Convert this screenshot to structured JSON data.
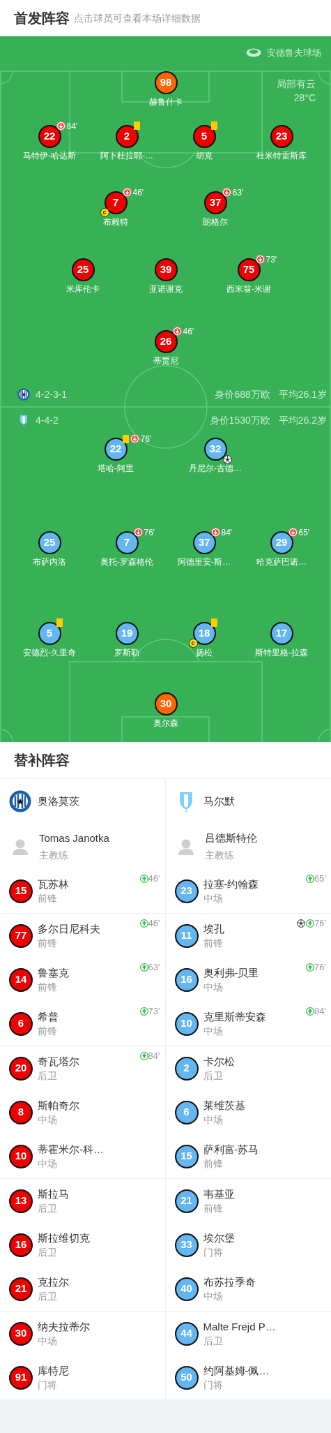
{
  "header": {
    "title": "首发阵容",
    "subtitle": "点击球员可查看本场详细数据"
  },
  "pitch": {
    "stadium": "安德鲁夫球场",
    "weather": {
      "condition": "局部有云",
      "temperature": "28°C"
    },
    "home_lines": [
      [
        {
          "number": "98",
          "name": "赫鲁什卡",
          "color": "#ff6600"
        }
      ],
      [
        {
          "number": "22",
          "name": "马特伊-哈达斯",
          "color": "#ee0000",
          "events": [
            {
              "kind": "sub_out",
              "minute": "84'"
            }
          ]
        },
        {
          "number": "2",
          "name": "阿卜杜拉耶-…",
          "color": "#ee0000",
          "events": [
            {
              "kind": "yellow"
            }
          ]
        },
        {
          "number": "5",
          "name": "胡克",
          "color": "#ee0000",
          "events": [
            {
              "kind": "yellow"
            }
          ]
        },
        {
          "number": "23",
          "name": "杜米特雷斯库",
          "color": "#ee0000"
        }
      ],
      [
        {
          "number": "7",
          "name": "布赖特",
          "color": "#ee0000",
          "events": [
            {
              "kind": "sub_out",
              "minute": "46'"
            },
            {
              "kind": "captain",
              "label": "c"
            }
          ]
        },
        {
          "number": "37",
          "name": "朗格尔",
          "color": "#ee0000",
          "events": [
            {
              "kind": "sub_out",
              "minute": "63'"
            }
          ]
        }
      ],
      [
        {
          "number": "25",
          "name": "米库伦卡",
          "color": "#ee0000"
        },
        {
          "number": "39",
          "name": "亚诺谢克",
          "color": "#ee0000"
        },
        {
          "number": "75",
          "name": "西米翁-米谢",
          "color": "#ee0000",
          "events": [
            {
              "kind": "sub_out",
              "minute": "73'"
            }
          ]
        }
      ],
      [
        {
          "number": "26",
          "name": "蒂贾尼",
          "color": "#ee0000",
          "events": [
            {
              "kind": "sub_out",
              "minute": "46'"
            }
          ]
        }
      ]
    ],
    "formations": [
      {
        "kind": "round",
        "formation": "4-2-3-1",
        "value": "身价688万欧",
        "avg_age": "平均26.1岁"
      },
      {
        "kind": "shield",
        "formation": "4-4-2",
        "value": "身价1530万欧",
        "avg_age": "平均26.2岁"
      }
    ],
    "away_lines": [
      [
        {
          "number": "22",
          "name": "塔哈-阿里",
          "color": "#63b6f0",
          "events": [
            {
              "kind": "yellow"
            },
            {
              "kind": "sub_out",
              "minute": "76'"
            }
          ]
        },
        {
          "number": "32",
          "name": "丹尼尔-古德…",
          "color": "#63b6f0",
          "events": [
            {
              "kind": "goal"
            }
          ]
        }
      ],
      [
        {
          "number": "25",
          "name": "布萨内洛",
          "color": "#63b6f0"
        },
        {
          "number": "7",
          "name": "奥托-罗森格伦",
          "color": "#63b6f0",
          "events": [
            {
              "kind": "sub_out",
              "minute": "76'"
            }
          ]
        },
        {
          "number": "37",
          "name": "阿德里安-斯…",
          "color": "#63b6f0",
          "events": [
            {
              "kind": "sub_out",
              "minute": "84'"
            }
          ]
        },
        {
          "number": "29",
          "name": "哈克萨巴诺…",
          "color": "#63b6f0",
          "events": [
            {
              "kind": "sub_out",
              "minute": "65'"
            }
          ]
        }
      ],
      [
        {
          "number": "5",
          "name": "安德烈-久里奇",
          "color": "#63b6f0",
          "events": [
            {
              "kind": "yellow"
            }
          ]
        },
        {
          "number": "19",
          "name": "罗斯勒",
          "color": "#63b6f0"
        },
        {
          "number": "18",
          "name": "扬松",
          "color": "#63b6f0",
          "events": [
            {
              "kind": "yellow"
            },
            {
              "kind": "captain",
              "label": "c"
            }
          ]
        },
        {
          "number": "17",
          "name": "斯特里格-拉森",
          "color": "#63b6f0"
        }
      ],
      [
        {
          "number": "30",
          "name": "奥尔森",
          "color": "#ff6600"
        }
      ]
    ]
  },
  "subs": {
    "title": "替补阵容",
    "teams": [
      {
        "kind": "round",
        "name": "奥洛莫茨",
        "color": "#ee0000",
        "coach": {
          "name": "Tomas Janotka",
          "role": "主教练"
        }
      },
      {
        "kind": "shield",
        "name": "马尔默",
        "color": "#63b6f0",
        "coach": {
          "name": "吕德斯特伦",
          "role": "主教练"
        }
      }
    ],
    "groups": [
      [
        {
          "home": {
            "number": "15",
            "name": "瓦苏林",
            "position": "前锋",
            "events": [
              {
                "kind": "sub_in",
                "minute": "46'"
              }
            ]
          },
          "away": {
            "number": "23",
            "name": "拉塞-约翰森",
            "position": "中场",
            "events": [
              {
                "kind": "sub_in",
                "minute": "65'"
              }
            ]
          }
        }
      ],
      [
        {
          "home": {
            "number": "77",
            "name": "多尔日尼科夫",
            "position": "前锋",
            "events": [
              {
                "kind": "sub_in",
                "minute": "46'"
              }
            ]
          },
          "away": {
            "number": "11",
            "name": "埃孔",
            "position": "前锋",
            "events": [
              {
                "kind": "goal"
              },
              {
                "kind": "sub_in",
                "minute": "76'"
              }
            ]
          }
        },
        {
          "home": {
            "number": "14",
            "name": "鲁塞克",
            "position": "前锋",
            "events": [
              {
                "kind": "sub_in",
                "minute": "63'"
              }
            ]
          },
          "away": {
            "number": "16",
            "name": "奥利弗-贝里",
            "position": "中场",
            "events": [
              {
                "kind": "sub_in",
                "minute": "76'"
              }
            ]
          }
        },
        {
          "home": {
            "number": "6",
            "name": "希普",
            "position": "前锋",
            "events": [
              {
                "kind": "sub_in",
                "minute": "73'"
              }
            ]
          },
          "away": {
            "number": "10",
            "name": "克里斯蒂安森",
            "position": "中场",
            "events": [
              {
                "kind": "sub_in",
                "minute": "84'"
              }
            ]
          }
        }
      ],
      [
        {
          "home": {
            "number": "20",
            "name": "奇瓦塔尔",
            "position": "后卫",
            "events": [
              {
                "kind": "sub_in",
                "minute": "84'"
              }
            ]
          },
          "away": {
            "number": "2",
            "name": "卡尔松",
            "position": "后卫"
          }
        },
        {
          "home": {
            "number": "8",
            "name": "斯帕奇尔",
            "position": "中场"
          },
          "away": {
            "number": "6",
            "name": "莱维茨基",
            "position": "中场"
          }
        },
        {
          "home": {
            "number": "10",
            "name": "蒂霍米尔-科…",
            "position": "中场"
          },
          "away": {
            "number": "15",
            "name": "萨利富-苏马",
            "position": "前锋"
          }
        }
      ],
      [
        {
          "home": {
            "number": "13",
            "name": "斯拉马",
            "position": "后卫"
          },
          "away": {
            "number": "21",
            "name": "韦基亚",
            "position": "前锋"
          }
        },
        {
          "home": {
            "number": "16",
            "name": "斯拉维切克",
            "position": "后卫"
          },
          "away": {
            "number": "33",
            "name": "埃尔堡",
            "position": "门将"
          }
        },
        {
          "home": {
            "number": "21",
            "name": "克拉尔",
            "position": "后卫"
          },
          "away": {
            "number": "40",
            "name": "布苏拉季奇",
            "position": "中场"
          }
        }
      ],
      [
        {
          "home": {
            "number": "30",
            "name": "纳夫拉蒂尔",
            "position": "中场"
          },
          "away": {
            "number": "44",
            "name": "Malte Frejd P…",
            "position": "后卫"
          }
        },
        {
          "home": {
            "number": "91",
            "name": "库特尼",
            "position": "门将"
          },
          "away": {
            "number": "50",
            "name": "约阿基姆-佩…",
            "position": "门将"
          }
        }
      ]
    ]
  }
}
